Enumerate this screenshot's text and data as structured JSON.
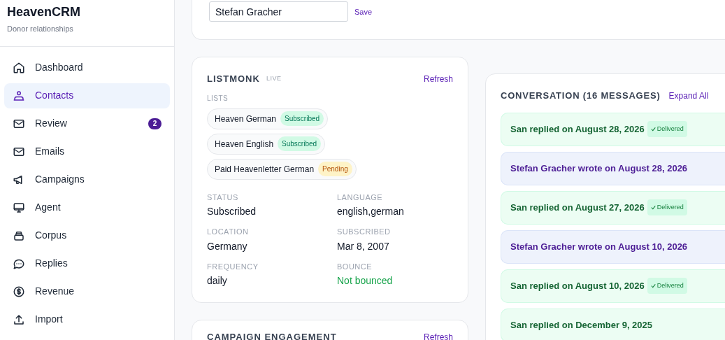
{
  "brand": {
    "title": "HeavenCRM",
    "subtitle": "Donor relationships"
  },
  "sidebar": {
    "items": [
      {
        "label": "Dashboard",
        "selected": false
      },
      {
        "label": "Contacts",
        "selected": true
      },
      {
        "label": "Review",
        "selected": false,
        "badge": "2"
      },
      {
        "label": "Emails",
        "selected": false
      },
      {
        "label": "Campaigns",
        "selected": false
      },
      {
        "label": "Agent",
        "selected": false
      },
      {
        "label": "Corpus",
        "selected": false
      },
      {
        "label": "Replies",
        "selected": false
      },
      {
        "label": "Revenue",
        "selected": false
      },
      {
        "label": "Import",
        "selected": false
      }
    ]
  },
  "name_form": {
    "value": "Stefan Gracher",
    "save": "Save"
  },
  "listmonk": {
    "title": "LISTMONK",
    "tag": "LIVE",
    "refresh": "Refresh",
    "lists_label": "LISTS",
    "lists": [
      {
        "name": "Heaven German",
        "status": "Subscribed",
        "kind": "subscribed"
      },
      {
        "name": "Heaven English",
        "status": "Subscribed",
        "kind": "subscribed"
      },
      {
        "name": "Paid Heavenletter German",
        "status": "Pending",
        "kind": "pending"
      }
    ],
    "fields": [
      {
        "label": "STATUS",
        "value": "Subscribed",
        "kind": "plain"
      },
      {
        "label": "LANGUAGE",
        "value": "english,german",
        "kind": "plain"
      },
      {
        "label": "LOCATION",
        "value": "Germany",
        "kind": "plain"
      },
      {
        "label": "SUBSCRIBED",
        "value": "Mar 8, 2007",
        "kind": "plain"
      },
      {
        "label": "FREQUENCY",
        "value": "daily",
        "kind": "plain"
      },
      {
        "label": "BOUNCE",
        "value": "Not bounced",
        "kind": "good"
      }
    ]
  },
  "campaign_engagement": {
    "title": "CAMPAIGN ENGAGEMENT",
    "refresh": "Refresh"
  },
  "conversation": {
    "title": "CONVERSATION (16 MESSAGES)",
    "expand": "Expand All",
    "messages": [
      {
        "kind": "reply",
        "text": "San replied on August 28, 2026",
        "delivered": "Delivered"
      },
      {
        "kind": "incoming",
        "text": "Stefan Gracher wrote on August 28, 2026"
      },
      {
        "kind": "reply",
        "text": "San replied on August 27, 2026",
        "delivered": "Delivered"
      },
      {
        "kind": "incoming",
        "text": "Stefan Gracher wrote on August 10, 2026"
      },
      {
        "kind": "reply",
        "text": "San replied on August 10, 2026",
        "delivered": "Delivered"
      },
      {
        "kind": "reply",
        "text": "San replied on December 9, 2025"
      }
    ]
  }
}
